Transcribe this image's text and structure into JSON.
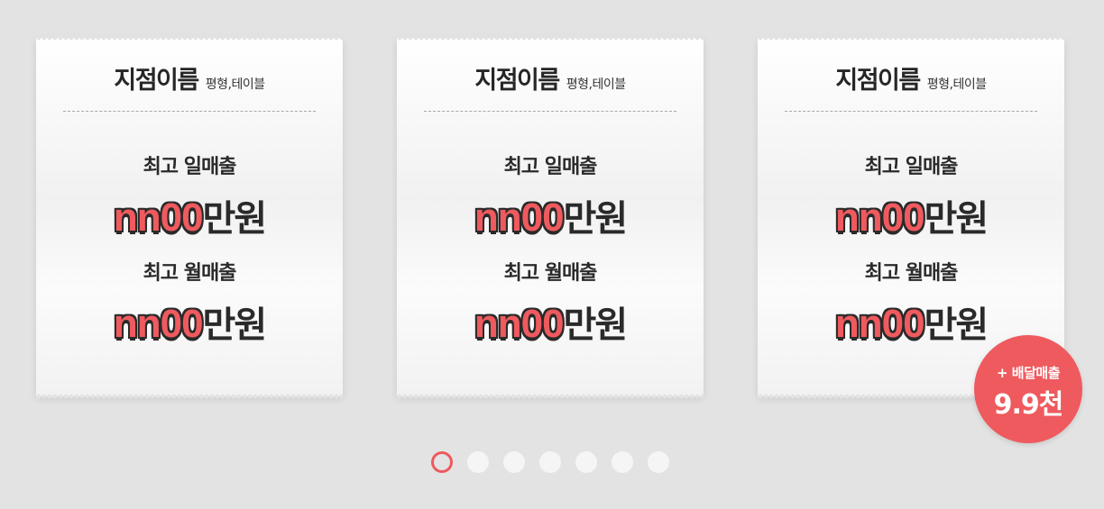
{
  "cards": [
    {
      "store_name": "지점이름",
      "store_detail": "평형,테이블",
      "daily_label": "최고 일매출",
      "daily_amount": "nn00",
      "daily_unit": "만원",
      "monthly_label": "최고 월매출",
      "monthly_amount": "nn00",
      "monthly_unit": "만원"
    },
    {
      "store_name": "지점이름",
      "store_detail": "평형,테이블",
      "daily_label": "최고 일매출",
      "daily_amount": "nn00",
      "daily_unit": "만원",
      "monthly_label": "최고 월매출",
      "monthly_amount": "nn00",
      "monthly_unit": "만원"
    },
    {
      "store_name": "지점이름",
      "store_detail": "평형,테이블",
      "daily_label": "최고 일매출",
      "daily_amount": "nn00",
      "daily_unit": "만원",
      "monthly_label": "최고 월매출",
      "monthly_amount": "nn00",
      "monthly_unit": "만원"
    }
  ],
  "badge": {
    "label": "+ 배달매출",
    "value": "9.9천"
  },
  "pagination": {
    "total": 7,
    "active_index": 0
  },
  "colors": {
    "accent": "#ee5a5e",
    "background": "#e3e3e3",
    "text": "#2a2a2a"
  }
}
